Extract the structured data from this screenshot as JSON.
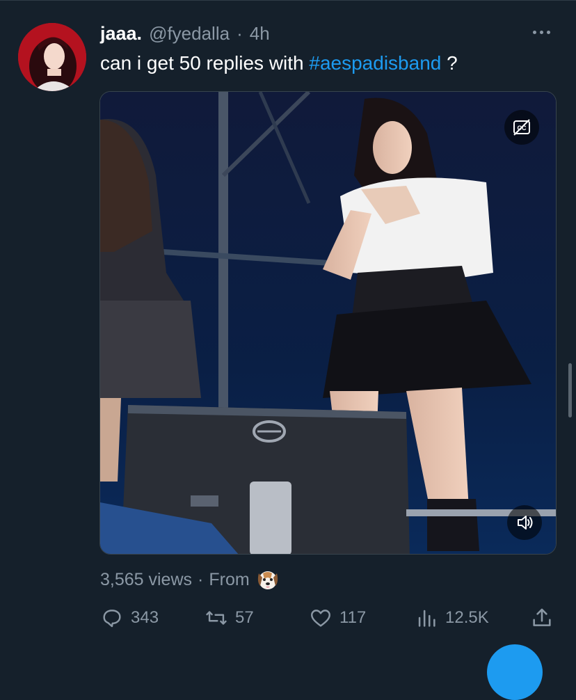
{
  "tweet": {
    "display_name": "jaaa.",
    "handle": "@fyedalla",
    "separator": "·",
    "time": "4h",
    "text_prefix": "can i get 50 replies with ",
    "hashtag": "#aespadisband",
    "text_suffix": " ?",
    "avatar_icon": "profile-avatar",
    "more_icon": "more-horizontal-icon"
  },
  "media": {
    "type": "video",
    "cc_icon": "closed-captions-icon",
    "mute_icon": "volume-icon"
  },
  "stats": {
    "views": "3,565 views",
    "separator": "·",
    "from_label": "From",
    "source_icon": "dog-emoji"
  },
  "actions": {
    "reply_count": "343",
    "retweet_count": "57",
    "like_count": "117",
    "analytics_count": "12.5K"
  },
  "colors": {
    "background": "#15202b",
    "accent": "#1d9bf0",
    "muted": "#8b98a5"
  }
}
